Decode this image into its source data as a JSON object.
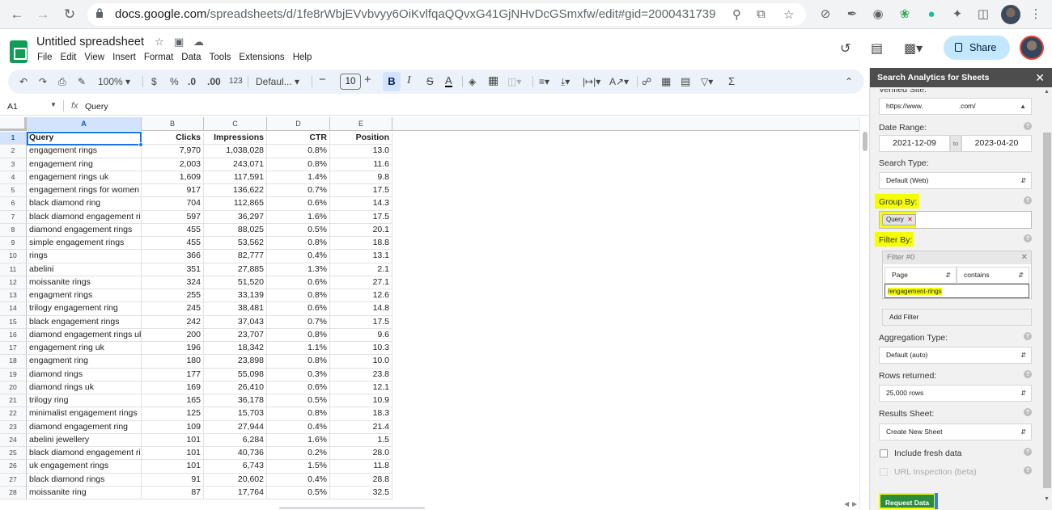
{
  "browser": {
    "url_host": "docs.google.com",
    "url_path": "/spreadsheets/d/1fe8rWbjEVvbvyy6OiKvlfqaQQvxG41GjNHvDcGSmxfw/edit#gid=2000431739"
  },
  "sheet": {
    "title": "Untitled spreadsheet",
    "menus": [
      "File",
      "Edit",
      "View",
      "Insert",
      "Format",
      "Data",
      "Tools",
      "Extensions",
      "Help"
    ],
    "share_label": "Share"
  },
  "toolbar": {
    "zoom": "100%",
    "currency": "$",
    "percent": "%",
    "dec_decrease": ".0",
    "dec_increase": ".00",
    "number_format": "123",
    "font": "Defaul...",
    "font_size": "10",
    "bold": "B",
    "italic": "I",
    "strike": "S",
    "text_color": "A"
  },
  "formula_bar": {
    "name_box": "A1",
    "fx": "fx",
    "value": "Query"
  },
  "grid": {
    "columns": [
      "A",
      "B",
      "C",
      "D",
      "E"
    ],
    "rows": [
      [
        "Query",
        "Clicks",
        "Impressions",
        "CTR",
        "Position"
      ],
      [
        "engagement rings",
        "7,970",
        "1,038,028",
        "0.8%",
        "13.0"
      ],
      [
        "engagement ring",
        "2,003",
        "243,071",
        "0.8%",
        "11.6"
      ],
      [
        "engagement rings uk",
        "1,609",
        "117,591",
        "1.4%",
        "9.8"
      ],
      [
        "engagement rings for women",
        "917",
        "136,622",
        "0.7%",
        "17.5"
      ],
      [
        "black diamond ring",
        "704",
        "112,865",
        "0.6%",
        "14.3"
      ],
      [
        "black diamond engagement rin",
        "597",
        "36,297",
        "1.6%",
        "17.5"
      ],
      [
        "diamond engagement rings",
        "455",
        "88,025",
        "0.5%",
        "20.1"
      ],
      [
        "simple engagement rings",
        "455",
        "53,562",
        "0.8%",
        "18.8"
      ],
      [
        "rings",
        "366",
        "82,777",
        "0.4%",
        "13.1"
      ],
      [
        "abelini",
        "351",
        "27,885",
        "1.3%",
        "2.1"
      ],
      [
        "moissanite rings",
        "324",
        "51,520",
        "0.6%",
        "27.1"
      ],
      [
        "engagment rings",
        "255",
        "33,139",
        "0.8%",
        "12.6"
      ],
      [
        "trilogy engagement ring",
        "245",
        "38,481",
        "0.6%",
        "14.8"
      ],
      [
        "black engagement rings",
        "242",
        "37,043",
        "0.7%",
        "17.5"
      ],
      [
        "diamond engagement rings uk",
        "200",
        "23,707",
        "0.8%",
        "9.6"
      ],
      [
        "engagement ring uk",
        "196",
        "18,342",
        "1.1%",
        "10.3"
      ],
      [
        "engagment ring",
        "180",
        "23,898",
        "0.8%",
        "10.0"
      ],
      [
        "diamond rings",
        "177",
        "55,098",
        "0.3%",
        "23.8"
      ],
      [
        "diamond rings uk",
        "169",
        "26,410",
        "0.6%",
        "12.1"
      ],
      [
        "trilogy ring",
        "165",
        "36,178",
        "0.5%",
        "10.9"
      ],
      [
        "minimalist engagement rings",
        "125",
        "15,703",
        "0.8%",
        "18.3"
      ],
      [
        "diamond engagement ring",
        "109",
        "27,944",
        "0.4%",
        "21.4"
      ],
      [
        "abelini jewellery",
        "101",
        "6,284",
        "1.6%",
        "1.5"
      ],
      [
        "black diamond engagement rin",
        "101",
        "40,736",
        "0.2%",
        "28.0"
      ],
      [
        "uk engagement rings",
        "101",
        "6,743",
        "1.5%",
        "11.8"
      ],
      [
        "black diamond rings",
        "91",
        "20,602",
        "0.4%",
        "28.8"
      ],
      [
        "moissanite ring",
        "87",
        "17,764",
        "0.5%",
        "32.5"
      ]
    ]
  },
  "sidebar": {
    "title": "Search Analytics for Sheets",
    "verified_site_label": "Verified Site:",
    "site_prefix": "https://www.",
    "site_suffix": ".com/",
    "date_range_label": "Date Range:",
    "date_from": "2021-12-09",
    "date_to_word": "to",
    "date_to": "2023-04-20",
    "search_type_label": "Search Type:",
    "search_type_value": "Default (Web)",
    "group_by_label": "Group By:",
    "group_by_chip": "Query",
    "filter_by_label": "Filter By:",
    "filter_title": "Filter #0",
    "filter_dimension": "Page",
    "filter_operator": "contains",
    "filter_value": "/engagement-rings",
    "add_filter_label": "Add Filter",
    "aggregation_label": "Aggregation Type:",
    "aggregation_value": "Default (auto)",
    "rows_label": "Rows returned:",
    "rows_value": "25,000 rows",
    "results_label": "Results Sheet:",
    "results_value": "Create New Sheet",
    "fresh_data_label": "Include fresh data",
    "url_inspection_label": "URL Inspection (beta)",
    "request_label": "Request Data"
  }
}
